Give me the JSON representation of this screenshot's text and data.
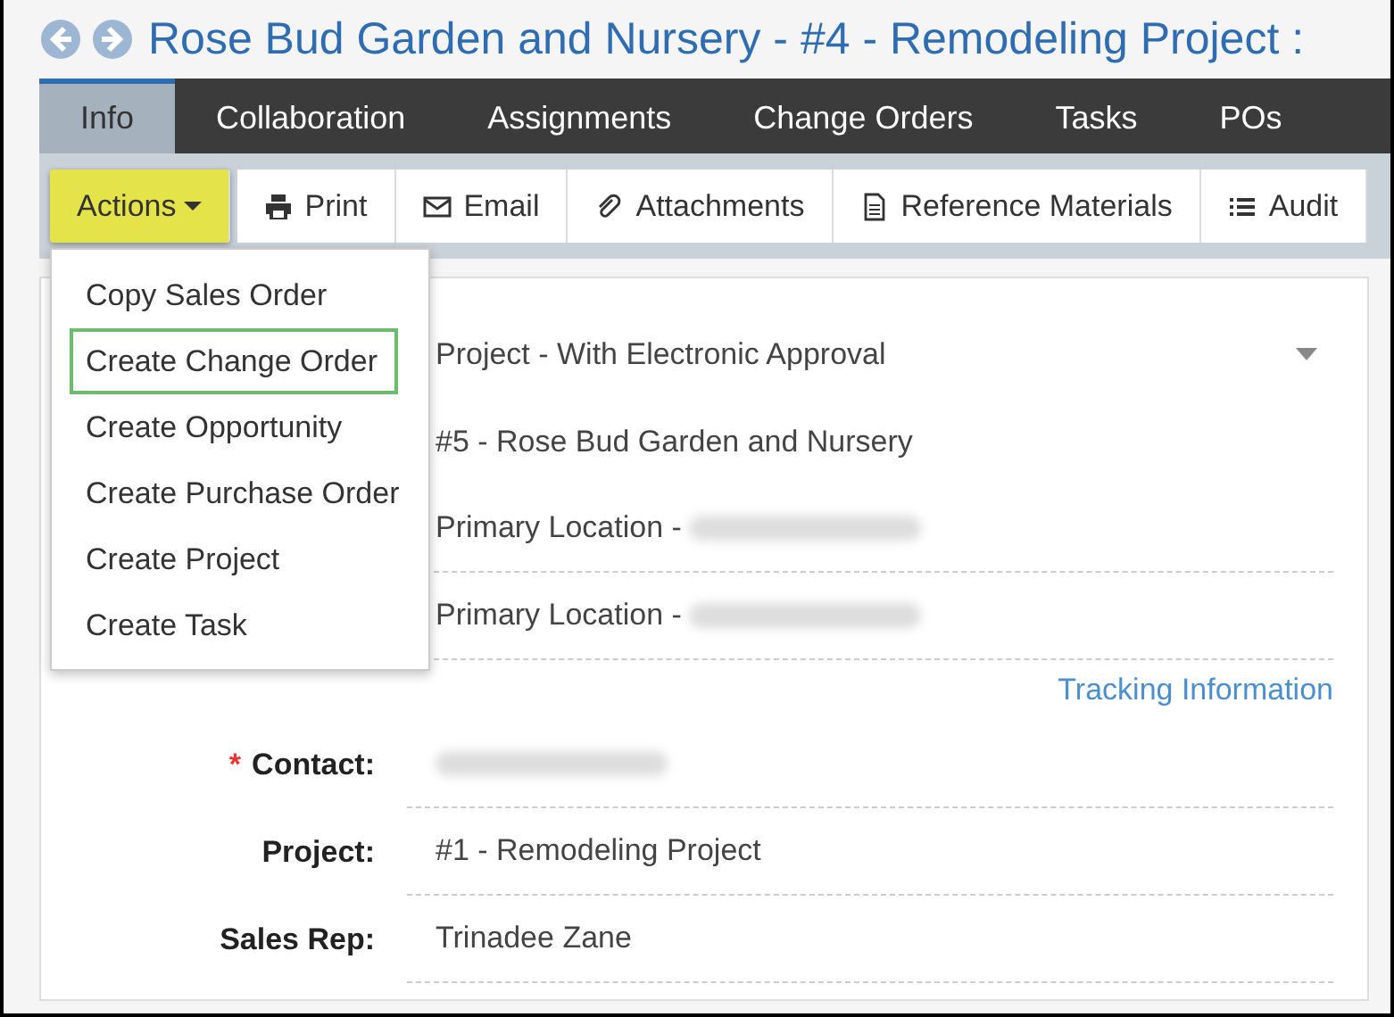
{
  "header": {
    "title": "Rose Bud Garden and Nursery - #4 - Remodeling Project :"
  },
  "tabs": [
    {
      "label": "Info",
      "selected": true
    },
    {
      "label": "Collaboration",
      "selected": false
    },
    {
      "label": "Assignments",
      "selected": false
    },
    {
      "label": "Change Orders",
      "selected": false
    },
    {
      "label": "Tasks",
      "selected": false
    },
    {
      "label": "POs",
      "selected": false
    }
  ],
  "toolbar": [
    {
      "label": "Actions",
      "kind": "dropdown"
    },
    {
      "label": "Print",
      "kind": "print"
    },
    {
      "label": "Email",
      "kind": "email"
    },
    {
      "label": "Attachments",
      "kind": "attach"
    },
    {
      "label": "Reference Materials",
      "kind": "document"
    },
    {
      "label": "Audit",
      "kind": "list"
    }
  ],
  "actions_menu": [
    {
      "label": "Copy Sales Order",
      "selected": false
    },
    {
      "label": "Create Change Order",
      "selected": true
    },
    {
      "label": "Create Opportunity",
      "selected": false
    },
    {
      "label": "Create Purchase Order",
      "selected": false
    },
    {
      "label": "Create Project",
      "selected": false
    },
    {
      "label": "Create Task",
      "selected": false
    }
  ],
  "fields": [
    {
      "kind": "select",
      "value": "Project - With Electronic Approval"
    },
    {
      "kind": "plain",
      "value": "#5 - Rose Bud Garden and Nursery"
    },
    {
      "kind": "field",
      "value": "Primary Location -",
      "blurred": true
    },
    {
      "kind": "field",
      "value": "Primary Location -",
      "blurred": true
    },
    {
      "kind": "link",
      "value": "Tracking Information"
    },
    {
      "kind": "field",
      "label": "Contact:",
      "required_mark": "*",
      "blurred": true
    },
    {
      "kind": "field",
      "label": "Project:",
      "value": "#1 - Remodeling Project"
    },
    {
      "kind": "field",
      "label": "Sales Rep:",
      "value": "Trinadee Zane"
    }
  ]
}
